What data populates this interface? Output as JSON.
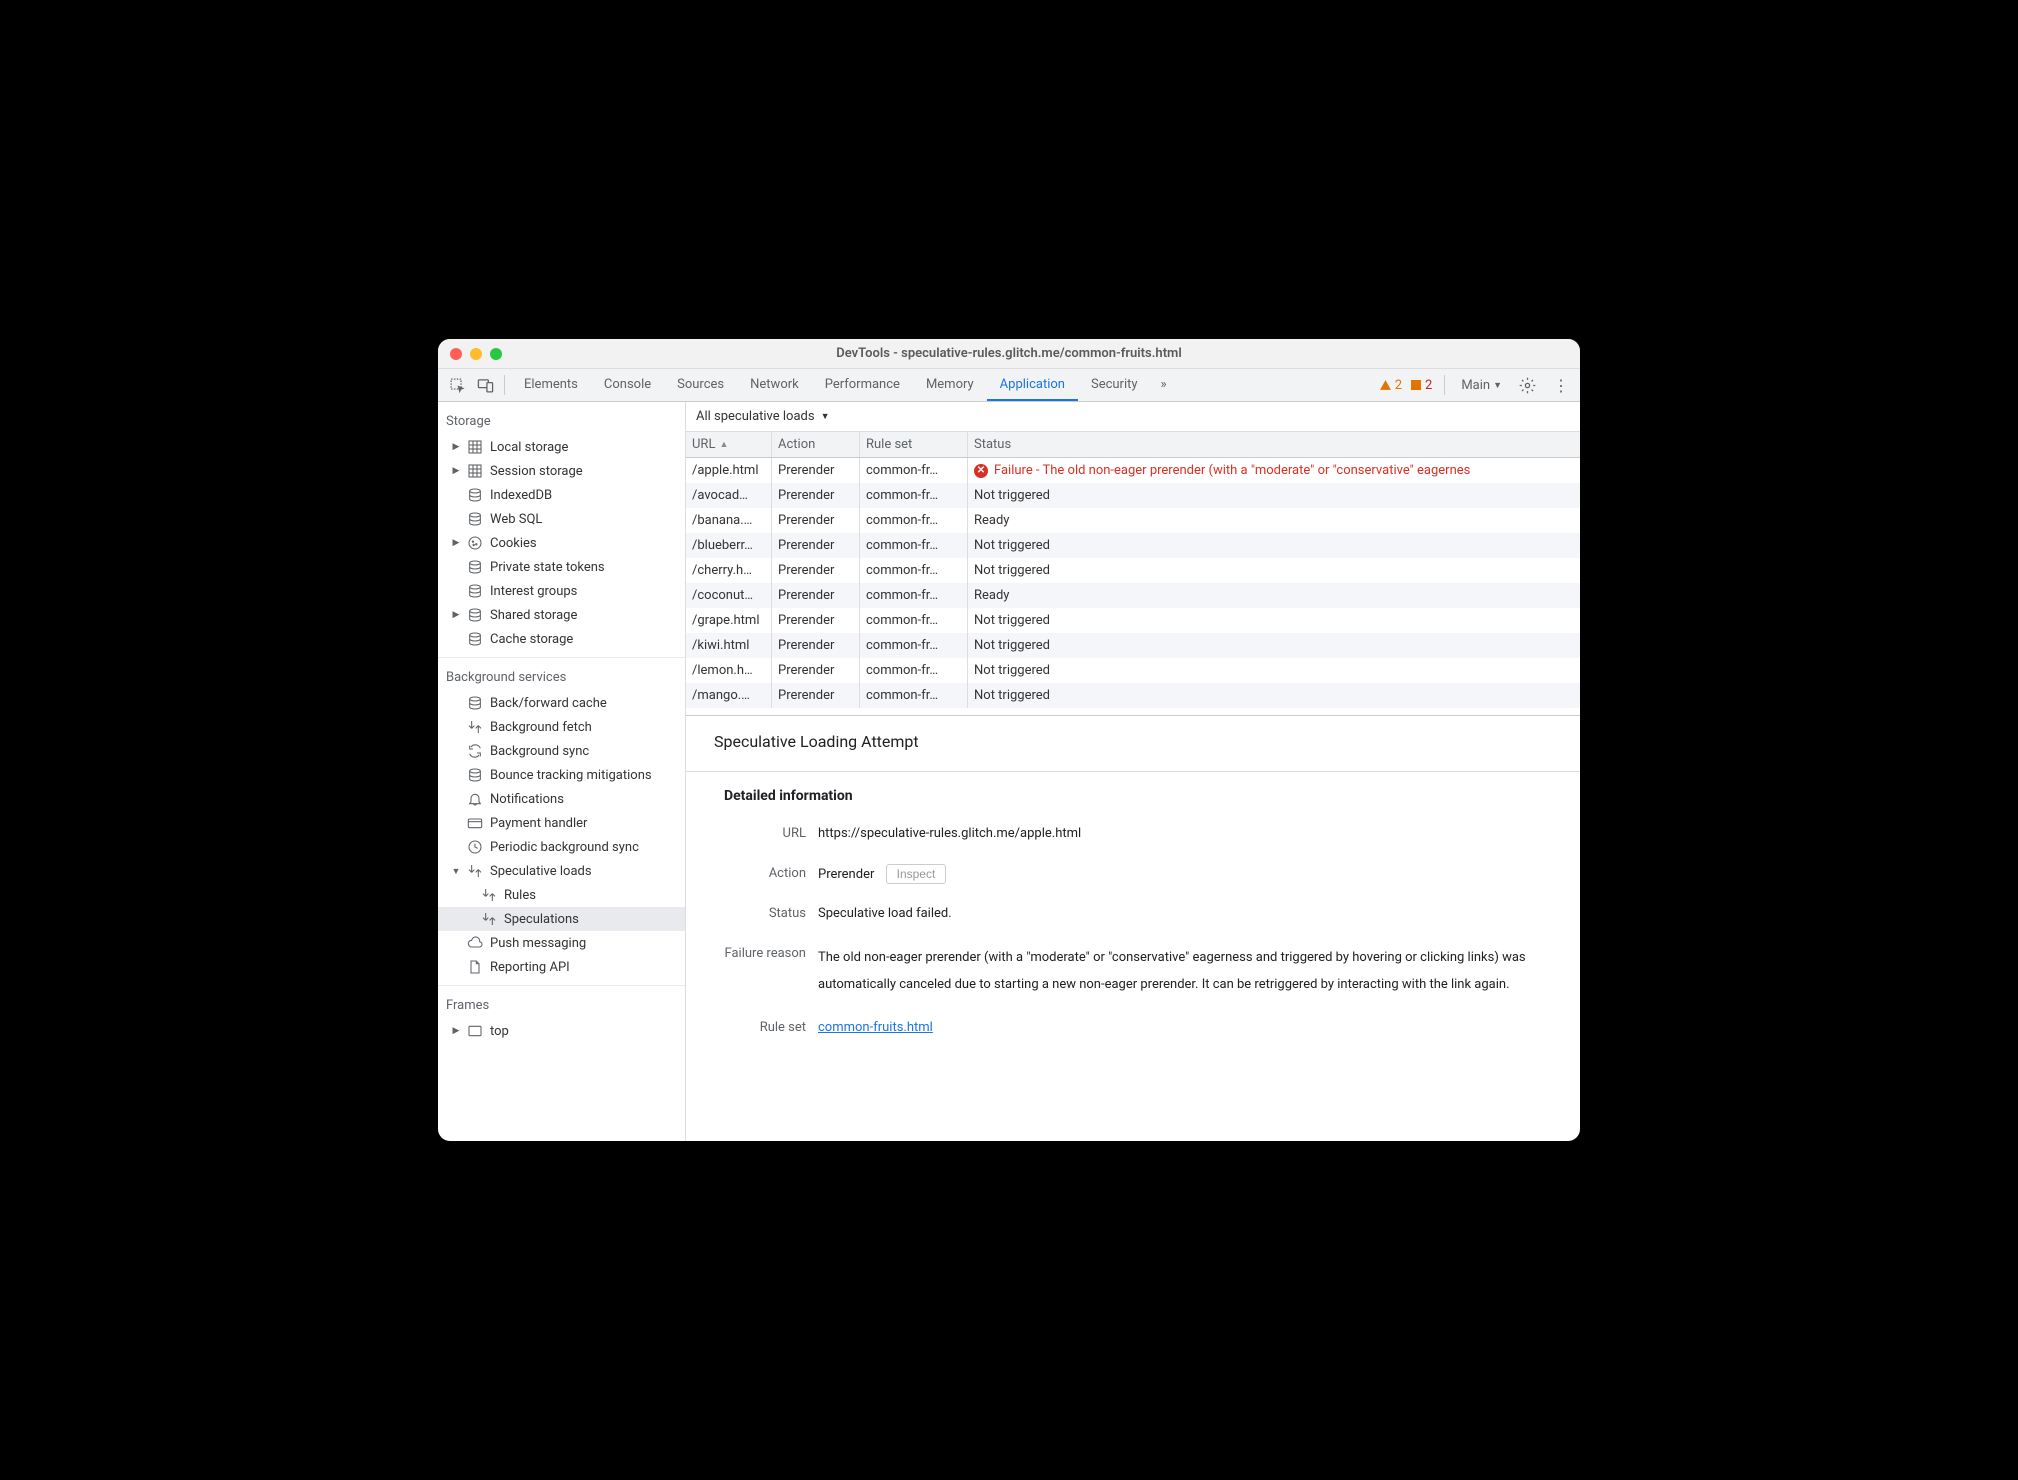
{
  "window_title": "DevTools - speculative-rules.glitch.me/common-fruits.html",
  "tabs": [
    "Elements",
    "Console",
    "Sources",
    "Network",
    "Performance",
    "Memory",
    "Application",
    "Security"
  ],
  "active_tab": "Application",
  "overflow_count": "»",
  "warnings": "2",
  "errors": "2",
  "target": "Main",
  "filter_label": "All speculative loads",
  "sidebar": {
    "storage_header": "Storage",
    "storage": [
      {
        "label": "Local storage",
        "icon": "grid",
        "exp": true
      },
      {
        "label": "Session storage",
        "icon": "grid",
        "exp": true
      },
      {
        "label": "IndexedDB",
        "icon": "db",
        "exp": false
      },
      {
        "label": "Web SQL",
        "icon": "db",
        "exp": false
      },
      {
        "label": "Cookies",
        "icon": "cookie",
        "exp": true
      },
      {
        "label": "Private state tokens",
        "icon": "db",
        "exp": false
      },
      {
        "label": "Interest groups",
        "icon": "db",
        "exp": false
      },
      {
        "label": "Shared storage",
        "icon": "db",
        "exp": true
      },
      {
        "label": "Cache storage",
        "icon": "db",
        "exp": false
      }
    ],
    "bg_header": "Background services",
    "bg": [
      {
        "label": "Back/forward cache",
        "icon": "db"
      },
      {
        "label": "Background fetch",
        "icon": "fetch"
      },
      {
        "label": "Background sync",
        "icon": "sync"
      },
      {
        "label": "Bounce tracking mitigations",
        "icon": "db"
      },
      {
        "label": "Notifications",
        "icon": "bell"
      },
      {
        "label": "Payment handler",
        "icon": "card"
      },
      {
        "label": "Periodic background sync",
        "icon": "clock"
      },
      {
        "label": "Speculative loads",
        "icon": "fetch",
        "expanded": true,
        "children": [
          {
            "label": "Rules",
            "icon": "fetch"
          },
          {
            "label": "Speculations",
            "icon": "fetch",
            "selected": true
          }
        ]
      },
      {
        "label": "Push messaging",
        "icon": "cloud"
      },
      {
        "label": "Reporting API",
        "icon": "file"
      }
    ],
    "frames_header": "Frames",
    "frames": [
      {
        "label": "top",
        "icon": "frame",
        "exp": true
      }
    ]
  },
  "table": {
    "headers": {
      "url": "URL",
      "action": "Action",
      "ruleset": "Rule set",
      "status": "Status"
    },
    "rows": [
      {
        "url": "/apple.html",
        "action": "Prerender",
        "ruleset": "common-fr…",
        "status": "Failure - The old non-eager prerender (with a \"moderate\" or \"conservative\" eagernes",
        "failure": true
      },
      {
        "url": "/avocad…",
        "action": "Prerender",
        "ruleset": "common-fr…",
        "status": "Not triggered"
      },
      {
        "url": "/banana.…",
        "action": "Prerender",
        "ruleset": "common-fr…",
        "status": "Ready"
      },
      {
        "url": "/blueberr…",
        "action": "Prerender",
        "ruleset": "common-fr…",
        "status": "Not triggered"
      },
      {
        "url": "/cherry.h…",
        "action": "Prerender",
        "ruleset": "common-fr…",
        "status": "Not triggered"
      },
      {
        "url": "/coconut…",
        "action": "Prerender",
        "ruleset": "common-fr…",
        "status": "Ready"
      },
      {
        "url": "/grape.html",
        "action": "Prerender",
        "ruleset": "common-fr…",
        "status": "Not triggered"
      },
      {
        "url": "/kiwi.html",
        "action": "Prerender",
        "ruleset": "common-fr…",
        "status": "Not triggered"
      },
      {
        "url": "/lemon.h…",
        "action": "Prerender",
        "ruleset": "common-fr…",
        "status": "Not triggered"
      },
      {
        "url": "/mango.…",
        "action": "Prerender",
        "ruleset": "common-fr…",
        "status": "Not triggered"
      }
    ]
  },
  "details": {
    "heading": "Speculative Loading Attempt",
    "subheading": "Detailed information",
    "url_label": "URL",
    "url": "https://speculative-rules.glitch.me/apple.html",
    "action_label": "Action",
    "action": "Prerender",
    "inspect": "Inspect",
    "status_label": "Status",
    "status": "Speculative load failed.",
    "reason_label": "Failure reason",
    "reason": "The old non-eager prerender (with a \"moderate\" or \"conservative\" eagerness and triggered by hovering or clicking links) was automatically canceled due to starting a new non-eager prerender. It can be retriggered by interacting with the link again.",
    "ruleset_label": "Rule set",
    "ruleset": "common-fruits.html"
  }
}
